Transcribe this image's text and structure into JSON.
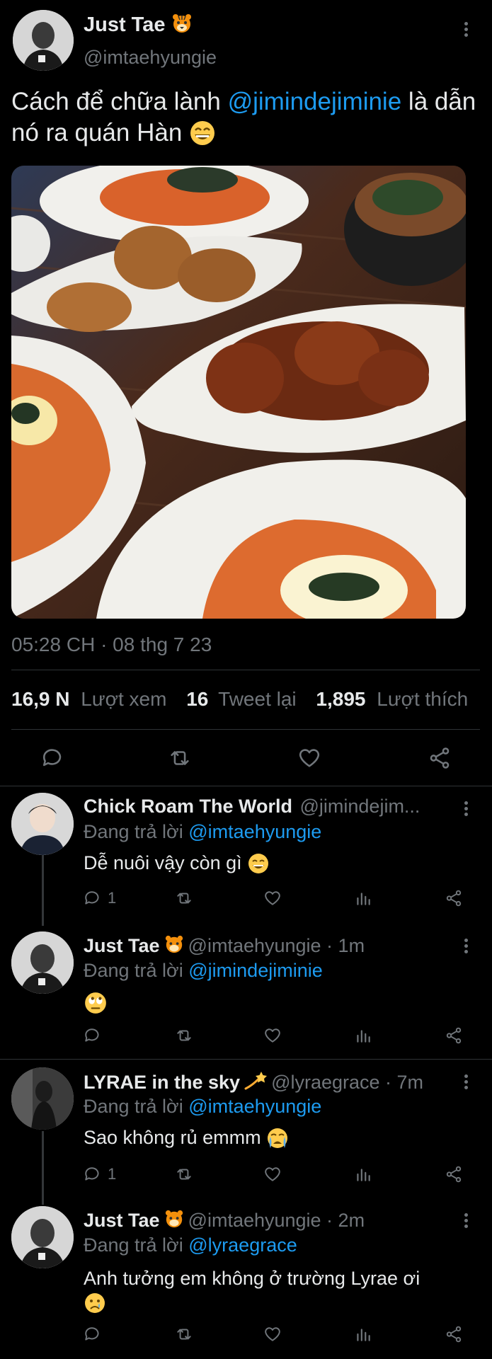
{
  "main_tweet": {
    "display_name": "Just Tae",
    "handle": "@imtaehyungie",
    "text_part1": "Cách để chữa lành ",
    "mention": "@jimindejiminie",
    "text_part2": " là dẫn nó ra quán Hàn",
    "emoji_icon": "grinning-face-emoji",
    "image_icon": "korean-food-photo",
    "timestamp": "05:28 CH · 08 thg 7 23",
    "stats": {
      "views_count": "16,9 N",
      "views_label": "Lượt xem",
      "retweets_count": "16",
      "retweets_label": "Tweet lại",
      "likes_count": "1,895",
      "likes_label": "Lượt thích"
    }
  },
  "replies": [
    {
      "display_name": "Chick Roam The World",
      "handle": "@jimindejim...",
      "time": "",
      "replying_label": "Đang trả lời ",
      "replying_to": "@imtaehyungie",
      "text": "Dễ nuôi vậy còn gì",
      "reply_count": "1"
    },
    {
      "display_name": "Just Tae",
      "handle": "@imtaehyungie · 1m",
      "time": "1m",
      "replying_label": "Đang trả lời ",
      "replying_to": "@jimindejiminie",
      "text": "",
      "reply_count": ""
    },
    {
      "display_name": "LYRAE in the sky",
      "handle": "@lyraegrace · 7m",
      "time": "7m",
      "replying_label": "Đang trả lời ",
      "replying_to": "@imtaehyungie",
      "text": "Sao không rủ emmm",
      "reply_count": "1"
    },
    {
      "display_name": "Just Tae",
      "handle": "@imtaehyungie · 2m",
      "time": "2m",
      "replying_label": "Đang trả lời ",
      "replying_to": "@lyraegrace",
      "text": "Anh tưởng em không ở trường Lyrae ơi",
      "reply_count": ""
    }
  ],
  "colors": {
    "background": "#000000",
    "text": "#e7e9ea",
    "secondary": "#71767b",
    "accent": "#1d9bf0",
    "divider": "#2f3336"
  }
}
